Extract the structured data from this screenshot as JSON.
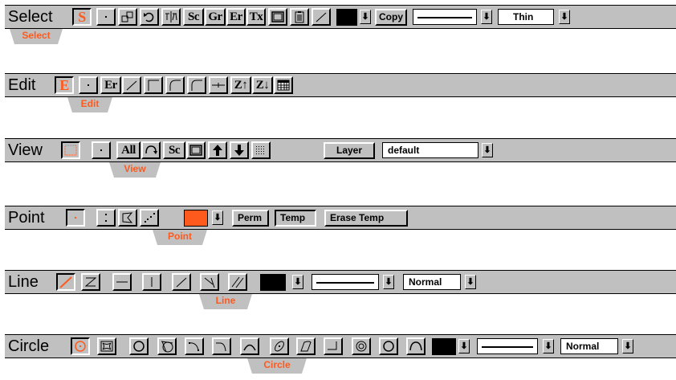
{
  "toolbars": {
    "select": {
      "title": "Select",
      "tab_label": "Select",
      "selected_glyph": "S",
      "buttons": [
        "Sc",
        "Gr",
        "Er",
        "Tx"
      ],
      "copy_label": "Copy",
      "width_value": "Thin",
      "dropdown_glyph": "⬇"
    },
    "edit": {
      "title": "Edit",
      "tab_label": "Edit",
      "selected_glyph": "E",
      "er_glyph": "Er",
      "z_up": "Z↑",
      "z_down": "Z↓"
    },
    "view": {
      "title": "View",
      "tab_label": "View",
      "all_glyph": "All",
      "sc_glyph": "Sc",
      "layer_label": "Layer",
      "layer_value": "default",
      "dropdown_glyph": "⬇"
    },
    "point": {
      "title": "Point",
      "tab_label": "Point",
      "perm_label": "Perm",
      "temp_label": "Temp",
      "erase_temp_label": "Erase Temp",
      "dropdown_glyph": "⬇"
    },
    "line": {
      "title": "Line",
      "tab_label": "Line",
      "style_value": "Normal",
      "dropdown_glyph": "⬇"
    },
    "circle": {
      "title": "Circle",
      "tab_label": "Circle",
      "style_value": "Normal",
      "dropdown_glyph": "⬇"
    }
  },
  "colors": {
    "accent": "#ff5a1e",
    "toolbar_bg": "#c0c0c0",
    "black_swatch": "#000000",
    "orange_swatch": "#ff5a1e"
  }
}
